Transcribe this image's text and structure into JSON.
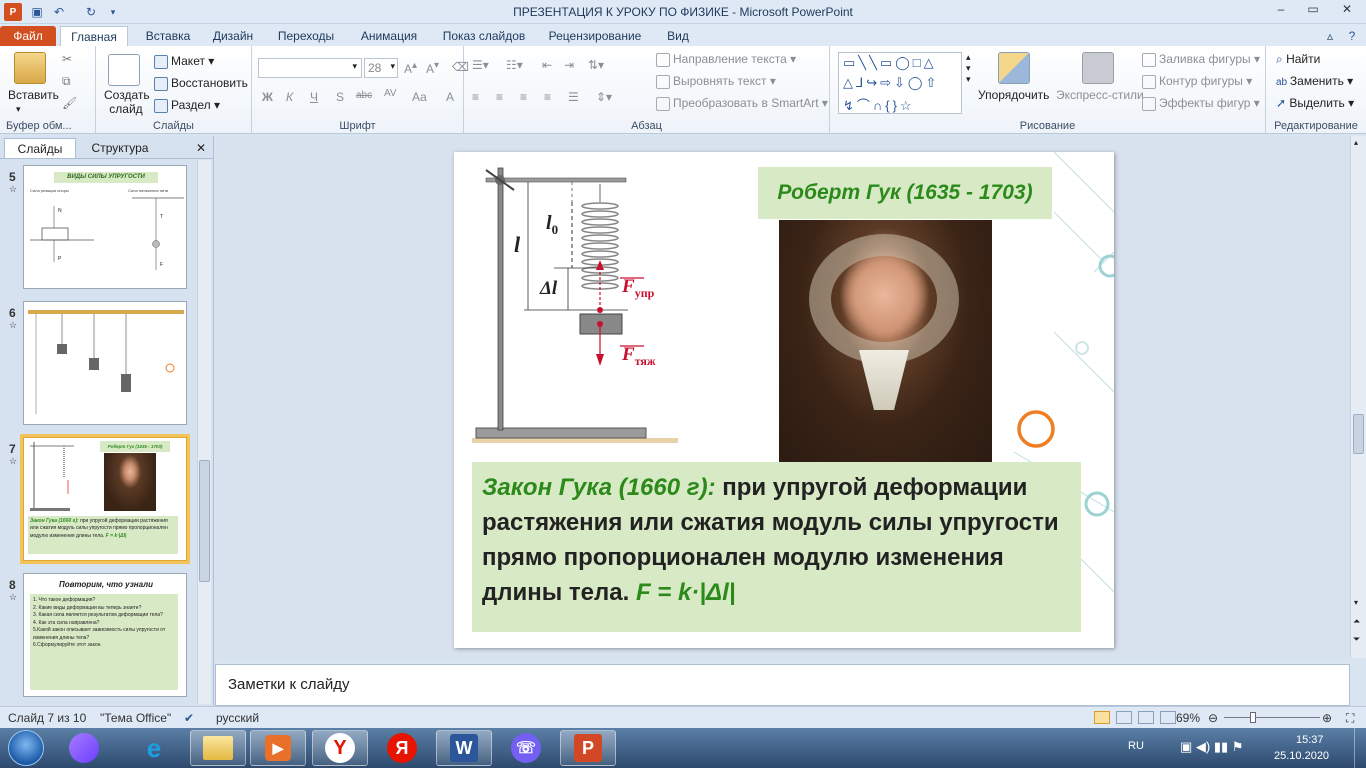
{
  "window": {
    "title": "ПРЕЗЕНТАЦИЯ К УРОКУ ПО ФИЗИКЕ  -  Microsoft PowerPoint"
  },
  "tabs": [
    "Файл",
    "Главная",
    "Вставка",
    "Дизайн",
    "Переходы",
    "Анимация",
    "Показ слайдов",
    "Рецензирование",
    "Вид"
  ],
  "ribbon": {
    "clipboard": {
      "paste": "Вставить",
      "label": "Буфер обм..."
    },
    "slides": {
      "new_slide": "Создать слайд",
      "layout": "Макет",
      "reset": "Восстановить",
      "section": "Раздел",
      "label": "Слайды"
    },
    "font": {
      "size": "28",
      "label": "Шрифт",
      "bold": "Ж",
      "italic": "К",
      "underline": "Ч",
      "strike": "S",
      "abc": "abc",
      "av": "AV",
      "aa": "Aa",
      "a": "A"
    },
    "paragraph": {
      "text_direction": "Направление текста",
      "align_text": "Выровнять текст",
      "smartart": "Преобразовать в SmartArt",
      "label": "Абзац"
    },
    "drawing": {
      "arrange": "Упорядочить",
      "quick_styles": "Экспресс-стили",
      "fill": "Заливка фигуры",
      "outline": "Контур фигуры",
      "effects": "Эффекты фигур",
      "label": "Рисование"
    },
    "editing": {
      "find": "Найти",
      "replace": "Заменить",
      "select": "Выделить",
      "label": "Редактирование"
    }
  },
  "panel_tabs": {
    "slides": "Слайды",
    "outline": "Структура"
  },
  "thumbnails": [
    {
      "num": "5",
      "title": "ВИДЫ СИЛЫ УПРУГОСТИ",
      "left_label": "Сила реакции опоры",
      "right_label": "Сила натяжения нити",
      "n": "N",
      "p": "P",
      "t": "T",
      "f": "F"
    },
    {
      "num": "6"
    },
    {
      "num": "7",
      "title": "Роберт Гук (1635 - 1703)",
      "text_green": "Закон Гука (1660 г):",
      "text": "при упругой деформации растяжения или сжатия модуль силы упругости прямо пропорционален модулю изменения длины тела.",
      "formula": "F = k·|Δl|"
    },
    {
      "num": "8",
      "title": "Повторим, что узнали",
      "items": [
        "1. Что такое деформация?",
        "2. Какие виды деформации вы теперь знаете?",
        "3. Какая сила является результатом деформации тела?",
        "4. Как эта сила направлена?",
        "5.Какой закон описывает зависимость силы упругости от изменения длины тела?",
        "6.Сформулируйте этот закон."
      ]
    }
  ],
  "slide": {
    "title": "Роберт Гук (1635 - 1703)",
    "law_title": "Закон Гука (1660 г):",
    "law_text": " при упругой деформации растяжения или сжатия модуль силы упругости прямо пропорционален модулю изменения длины тела. ",
    "formula": "F = k·|Δl|",
    "diagram": {
      "l": "l",
      "l0": "l",
      "l0_sub": "0",
      "dl": "Δl",
      "f_upr": "F",
      "f_upr_sub": "упр",
      "f_tyazh": "F",
      "f_tyazh_sub": "тяж"
    }
  },
  "notes": {
    "placeholder": "Заметки к слайду"
  },
  "status": {
    "slide": "Слайд 7 из 10",
    "theme": "\"Тема Office\"",
    "lang": "русский",
    "zoom": "69%"
  },
  "taskbar": {
    "lang": "RU",
    "time": "15:37",
    "date": "25.10.2020"
  }
}
